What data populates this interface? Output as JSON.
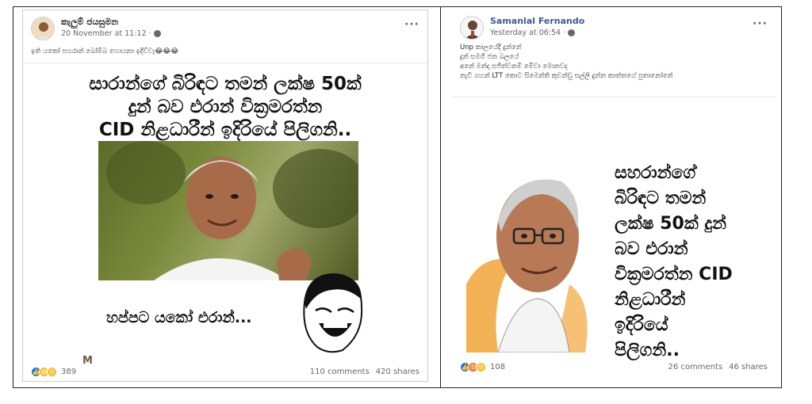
{
  "left_post": {
    "author": "කැලුම් ජයසුමන",
    "timestamp": "20 November at 11:12 ·",
    "caption": "ඉති යකෝ පහරාන් බෝම්බ හොයනා ඉදිව්වැ😂😂😂",
    "headline_lines": [
      "සාරාන්ගේ බිරිඳට තමන් ලක්ෂ 50ක්",
      "දුන් බව එරාන් වික්‍රමරත්න",
      "CID නිළධාරීන් ඉදිරියේ පිලිගනි.."
    ],
    "meme_text": "හප්පට යකෝ එරාන්...",
    "logo_mark": "M",
    "reaction_count": "389",
    "comments": "110 comments",
    "shares": "420 shares",
    "colors": {
      "like": "#1877f2",
      "haha": "#f7b928",
      "wow": "#f7b928"
    },
    "reaction_icons": [
      "like-icon",
      "haha-icon",
      "wow-icon"
    ]
  },
  "right_post": {
    "author": "Samanlal Fernando",
    "timestamp": "Yesterday at 06:54 ·",
    "caption_lines": [
      "Unp කාලයේදී දුන්නේ",
      "දුන් සමගි ජන බලයේ",
      "අනේ මන්දා සජිත්වනම් මේවා මොනවද",
      "නැවි ගහන් LTT කොට සිමෙන්ති කුවන්ඩු සල්ලි දුන්න කාත්තගේ පුතානෝනේ"
    ],
    "poster_lines": [
      "සහරාන්ගේ",
      "බිරිඳට තමන්",
      "ලක්ෂ 50ක් දුන්",
      "බව එරාන්",
      "වික්‍රමරත්න CID",
      "නිළධාරීන්",
      "ඉදිරියේ",
      "පිලිගනි.."
    ],
    "reaction_count": "108",
    "comments": "26 comments",
    "shares": "46 shares",
    "colors": {
      "like": "#1877f2",
      "angry": "#e9710f",
      "sad": "#f7b928"
    },
    "reaction_icons": [
      "like-icon",
      "angry-icon",
      "sad-icon"
    ]
  },
  "more_label": "···"
}
